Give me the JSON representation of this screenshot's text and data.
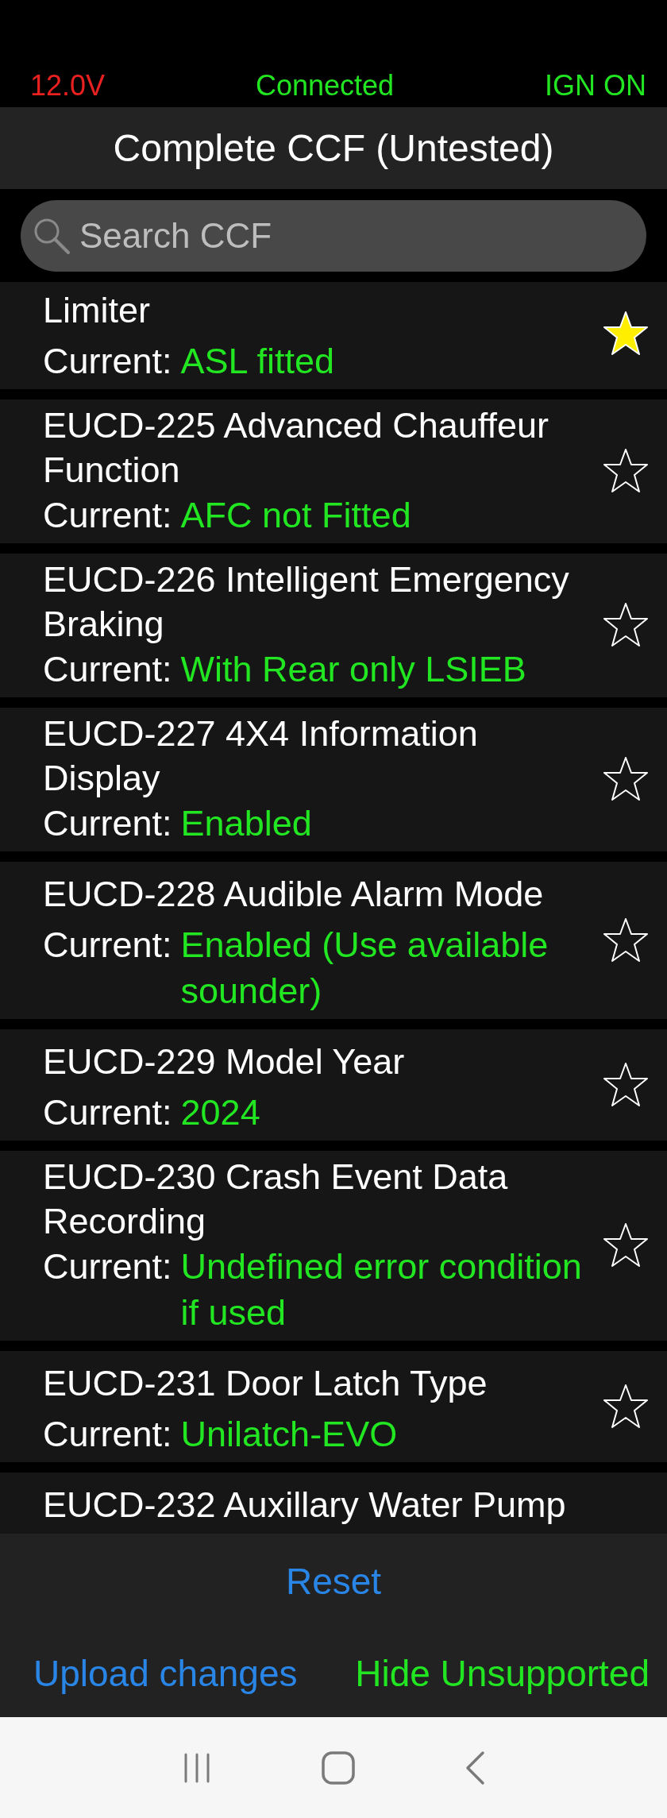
{
  "status_bar": {
    "voltage": "12.0V",
    "connection": "Connected",
    "ignition": "IGN ON"
  },
  "title": "Complete CCF (Untested)",
  "search": {
    "placeholder": "Search CCF"
  },
  "items": [
    {
      "title": "Limiter",
      "label": "Current:",
      "value": "ASL fitted",
      "starred": true
    },
    {
      "title": "EUCD-225 Advanced Chauffeur Function",
      "label": "Current:",
      "value": "AFC not Fitted",
      "starred": false
    },
    {
      "title": "EUCD-226 Intelligent Emergency Braking",
      "label": "Current:",
      "value": "With Rear only LSIEB",
      "starred": false
    },
    {
      "title": "EUCD-227 4X4 Information Display",
      "label": "Current:",
      "value": "Enabled",
      "starred": false
    },
    {
      "title": "EUCD-228 Audible Alarm Mode",
      "label": "Current:",
      "value": "Enabled (Use available sounder)",
      "starred": false
    },
    {
      "title": "EUCD-229 Model Year",
      "label": "Current:",
      "value": "2024",
      "starred": false
    },
    {
      "title": "EUCD-230 Crash Event Data Recording",
      "label": "Current:",
      "value": "Undefined error condition if used",
      "starred": false
    },
    {
      "title": "EUCD-231 Door Latch Type",
      "label": "Current:",
      "value": "Unilatch-EVO",
      "starred": false
    },
    {
      "title": "EUCD-232 Auxillary Water Pump"
    }
  ],
  "buttons": {
    "reset": "Reset",
    "upload": "Upload changes",
    "hide": "Hide Unsupported"
  }
}
